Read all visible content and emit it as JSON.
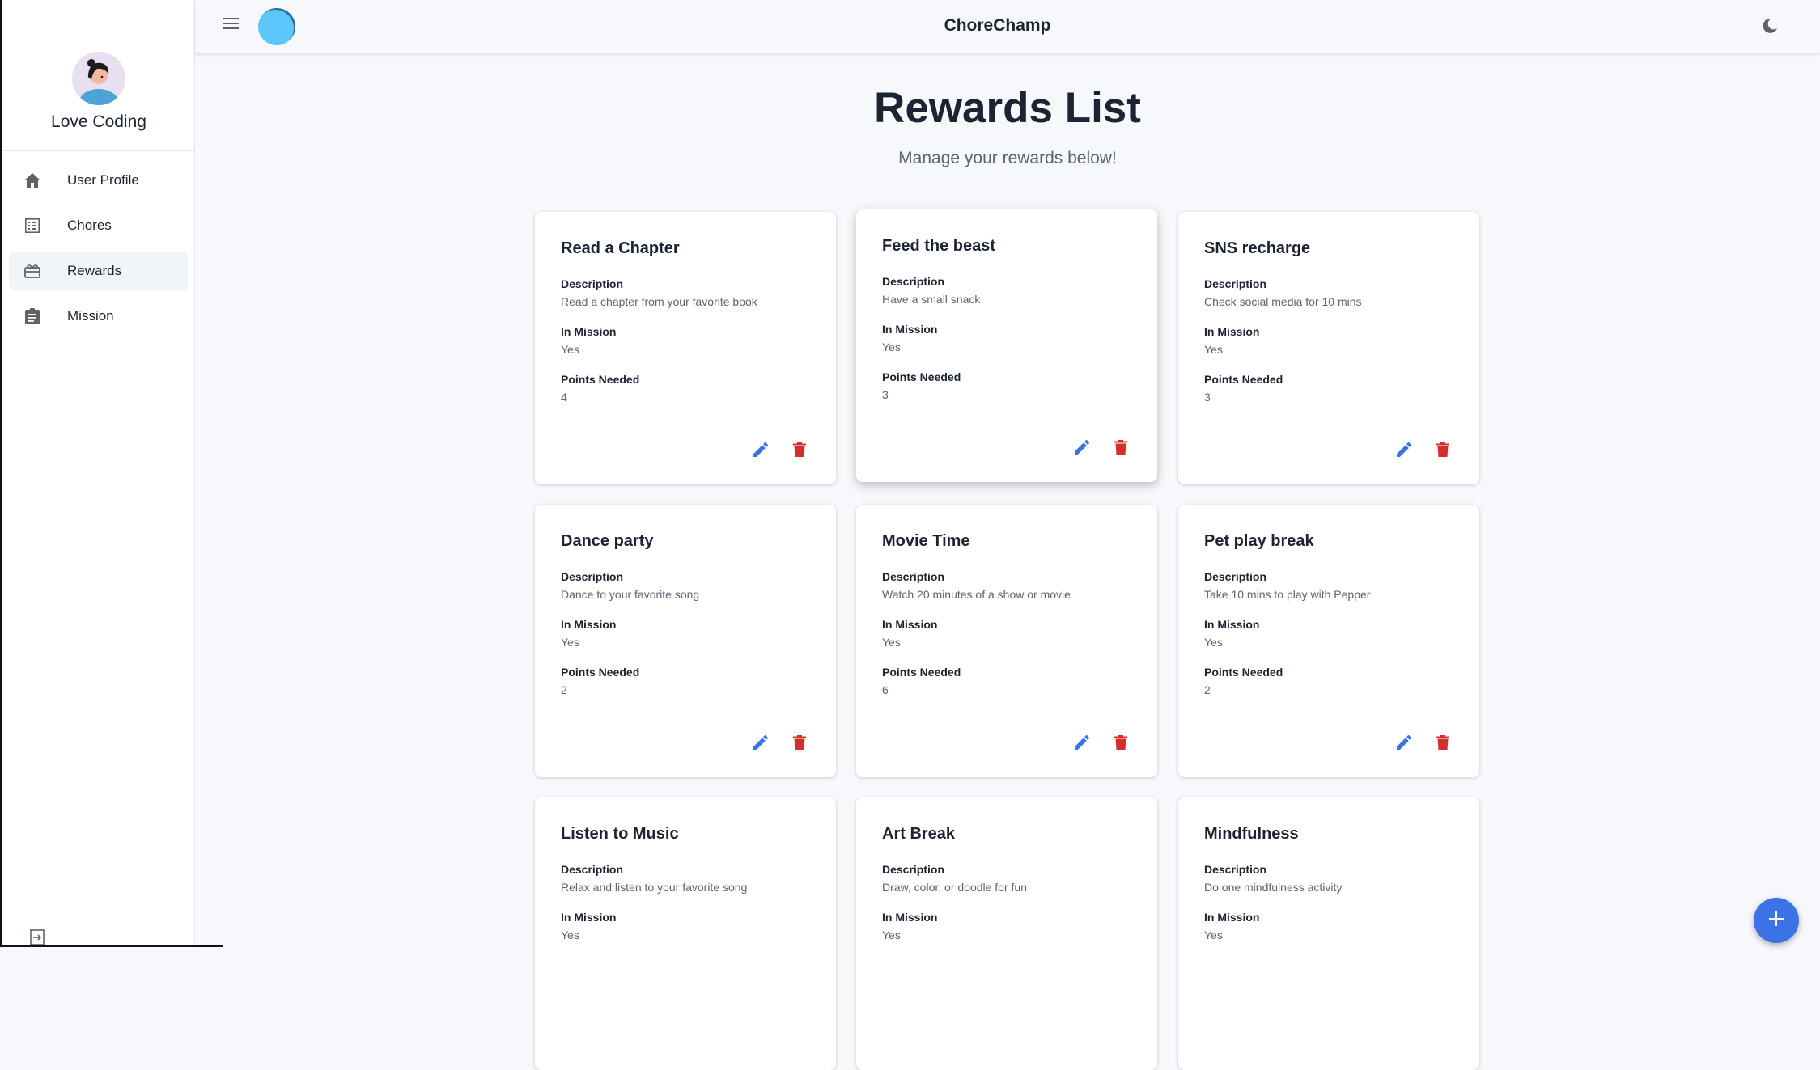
{
  "app": {
    "title": "ChoreChamp"
  },
  "sidebar": {
    "user_name": "Love Coding",
    "items": [
      {
        "label": "User Profile",
        "icon": "home-icon"
      },
      {
        "label": "Chores",
        "icon": "list-icon"
      },
      {
        "label": "Rewards",
        "icon": "rewards-icon",
        "active": true
      },
      {
        "label": "Mission",
        "icon": "assignment-icon"
      }
    ]
  },
  "page": {
    "title": "Rewards List",
    "subtitle": "Manage your rewards below!"
  },
  "labels": {
    "description": "Description",
    "in_mission": "In Mission",
    "points_needed": "Points Needed"
  },
  "rewards": [
    {
      "title": "Read a Chapter",
      "description": "Read a chapter from your favorite book",
      "in_mission": "Yes",
      "points": "4"
    },
    {
      "title": "Feed the beast",
      "description": "Have a small snack",
      "in_mission": "Yes",
      "points": "3"
    },
    {
      "title": "SNS recharge",
      "description": "Check social media for 10 mins",
      "in_mission": "Yes",
      "points": "3"
    },
    {
      "title": "Dance party",
      "description": "Dance to your favorite song",
      "in_mission": "Yes",
      "points": "2"
    },
    {
      "title": "Movie Time",
      "description": "Watch 20 minutes of a show or movie",
      "in_mission": "Yes",
      "points": "6"
    },
    {
      "title": "Pet play break",
      "description": "Take 10 mins to play with Pepper",
      "in_mission": "Yes",
      "points": "2"
    },
    {
      "title": "Listen to Music",
      "description": "Relax and listen to your favorite song",
      "in_mission": "Yes",
      "points": ""
    },
    {
      "title": "Art Break",
      "description": "Draw, color, or doodle for fun",
      "in_mission": "Yes",
      "points": ""
    },
    {
      "title": "Mindfulness",
      "description": "Do one mindfulness activity",
      "in_mission": "Yes",
      "points": ""
    }
  ],
  "colors": {
    "accent": "#3b73e6",
    "edit": "#3b73e6",
    "delete": "#d32f2f",
    "logo": "#5bc7fa"
  }
}
